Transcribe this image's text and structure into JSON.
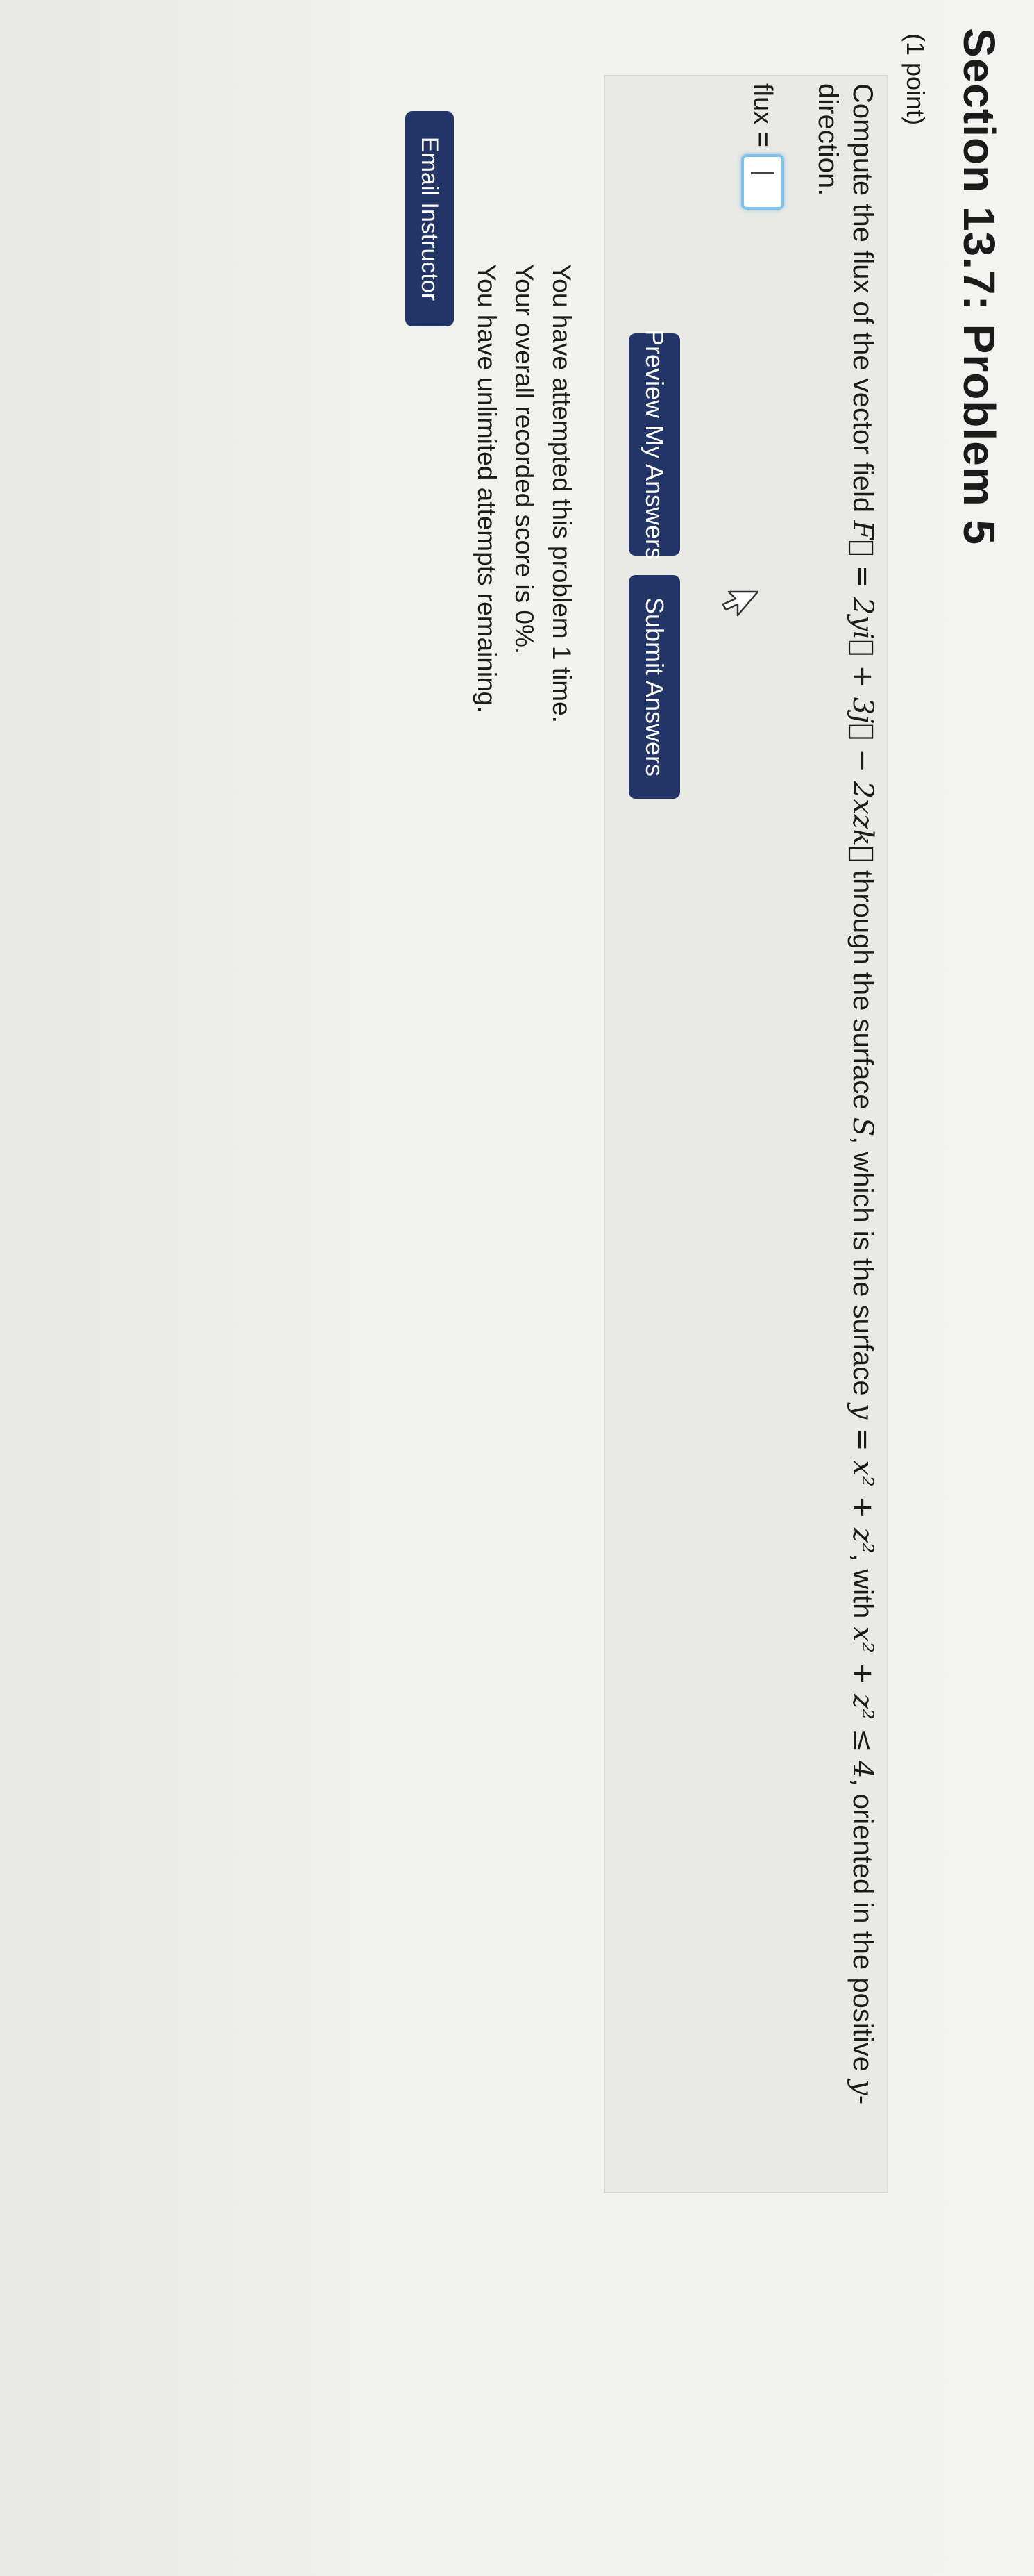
{
  "section": {
    "title": "Section 13.7: Problem 5",
    "points": "(1 point)"
  },
  "problem": {
    "text_before_field": "Compute the flux of the vector field ",
    "field_expression": "F⃗ = 2yi⃗ + 3j⃗ − 2xzk⃗",
    "text_middle": " through the surface ",
    "surface_symbol": "S",
    "text_surface": ", which is the surface ",
    "surface_expression": "y = x² + z²",
    "text_with": ", with ",
    "domain_expression": "x² + z² ≤ 4",
    "text_after": ", oriented in the positive ",
    "direction_symbol": "y",
    "text_end": "-direction."
  },
  "answer": {
    "label": "flux =",
    "value": ""
  },
  "buttons": {
    "preview": "Preview My Answers",
    "submit": "Submit Answers",
    "email": "Email Instructor"
  },
  "status": {
    "attempted": "You have attempted this problem 1 time.",
    "score": "Your overall recorded score is 0%.",
    "remaining": "You have unlimited attempts remaining."
  },
  "colors": {
    "button_bg": "#233466",
    "answer_focus": "#7fc4ea"
  }
}
